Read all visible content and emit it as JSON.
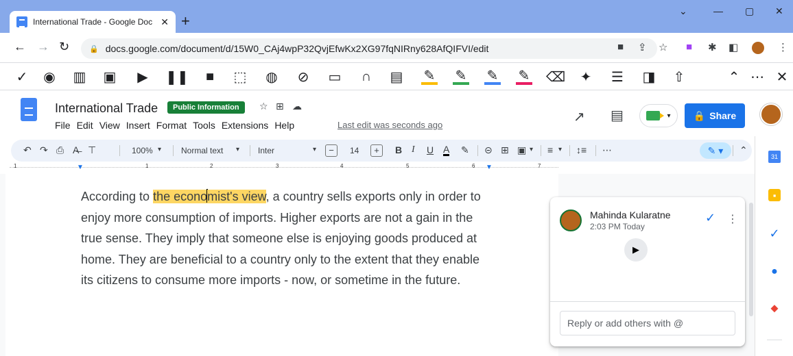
{
  "browser": {
    "tab_title": "International Trade - Google Doc",
    "tab_close": "✕",
    "new_tab": "+",
    "url": "docs.google.com/document/d/15W0_CAj4wpP32QvjEfwKx2XG97fqNIRny628AfQIFVI/edit",
    "window_controls": [
      "⌄",
      "—",
      "▢",
      "✕"
    ]
  },
  "docs": {
    "title": "International Trade",
    "badge": "Public Information",
    "menu": [
      "File",
      "Edit",
      "View",
      "Insert",
      "Format",
      "Tools",
      "Extensions",
      "Help"
    ],
    "last_edit": "Last edit was seconds ago",
    "share_label": "Share"
  },
  "format_toolbar": {
    "zoom": "100%",
    "style": "Normal text",
    "font": "Inter",
    "font_size": "14"
  },
  "ruler": [
    "1",
    "1",
    "2",
    "3",
    "4",
    "5",
    "6",
    "7"
  ],
  "document": {
    "before": "According to ",
    "highlight_a": "the econo",
    "highlight_b": "mist's view",
    "after": ", a country sells exports only in order to enjoy more consumption of imports. Higher exports are not a gain in the true sense. They imply that someone else is enjoying goods produced at home. They are beneficial to a country only to the extent that they enable its citizens to consume more imports - now, or sometime in the future."
  },
  "comment": {
    "author": "Mahinda Kularatne",
    "time": "2:03 PM Today",
    "reply_placeholder": "Reply or add others with @"
  },
  "colors": {
    "highlight": "#fdd663",
    "share_blue": "#1a73e8",
    "badge_green": "#188038",
    "chrome_frame": "#87a9ea"
  }
}
